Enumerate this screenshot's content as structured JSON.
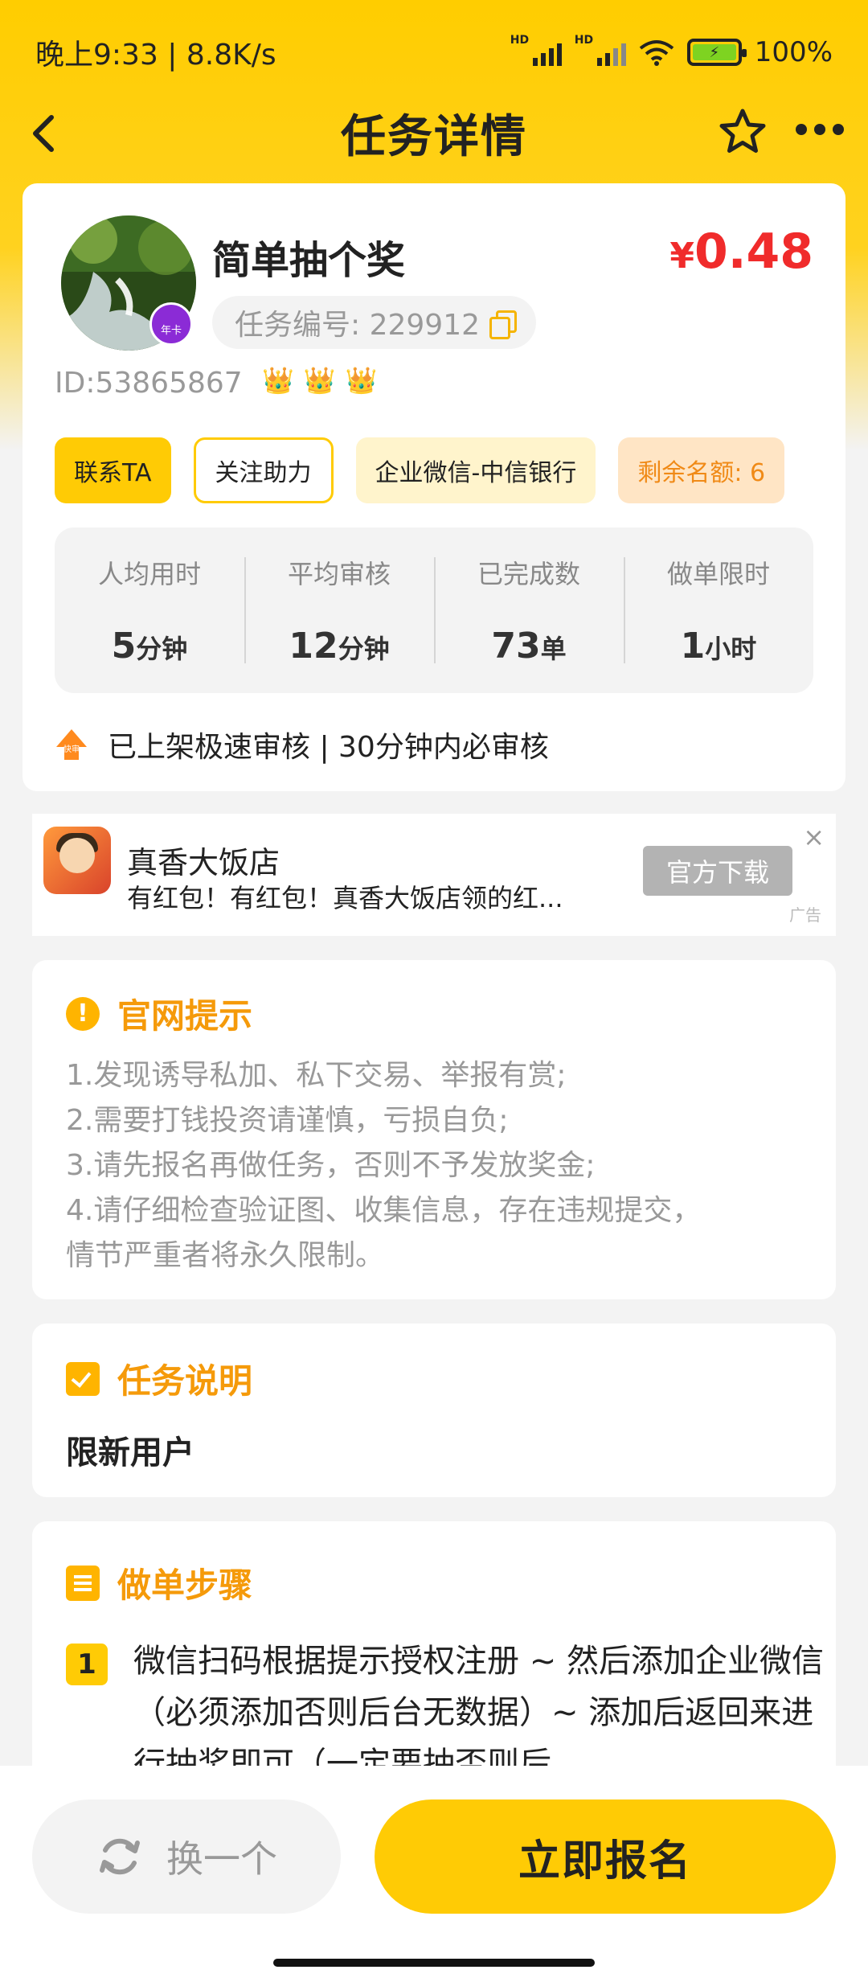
{
  "status_bar": {
    "time_speed": "晚上9:33 | 8.8K/s",
    "battery": "100%",
    "hd1": "HD",
    "hd2": "HD"
  },
  "header": {
    "title": "任务详情"
  },
  "task": {
    "name": "简单抽个奖",
    "price_currency": "¥",
    "price_value": "0.48",
    "task_id_label": "任务编号: 229912",
    "user_id": "ID:53865867",
    "avatar_badge": "年卡",
    "crowns": [
      "👑",
      "👑",
      "👑"
    ]
  },
  "tags": {
    "contact": "联系TA",
    "follow": "关注助力",
    "company": "企业微信-中信银行",
    "remaining": "剩余名额: 6"
  },
  "stats": [
    {
      "label": "人均用时",
      "value": "5",
      "unit": "分钟"
    },
    {
      "label": "平均审核",
      "value": "12",
      "unit": "分钟"
    },
    {
      "label": "已完成数",
      "value": "73",
      "unit": "单"
    },
    {
      "label": "做单限时",
      "value": "1",
      "unit": "小时"
    }
  ],
  "fast_review": {
    "icon_text": "快审",
    "text": "已上架极速审核 | 30分钟内必审核"
  },
  "ad": {
    "title": "真香大饭店",
    "description": "有红包！有红包！真香大饭店领的红...",
    "button": "官方下载",
    "close": "×",
    "label": "广告"
  },
  "notice": {
    "title": "官网提示",
    "lines": [
      "1.发现诱导私加、私下交易、举报有赏;",
      "2.需要打钱投资请谨慎，亏损自负;",
      "3.请先报名再做任务，否则不予发放奖金;",
      "4.请仔细检查验证图、收集信息，存在违规提交，",
      "情节严重者将永久限制。"
    ]
  },
  "description": {
    "title": "任务说明",
    "body": "限新用户"
  },
  "steps": {
    "title": "做单步骤",
    "items": [
      {
        "num": "1",
        "text": "微信扫码根据提示授权注册 ~ 然后添加企业微信（必须添加否则后台无数据）~ 添加后返回来进行抽奖即可（一定要抽否则后"
      }
    ]
  },
  "bottom": {
    "change": "换一个",
    "signup": "立即报名"
  },
  "colors": {
    "brand_yellow": "#ffcb05",
    "price_red": "#f02b2b",
    "section_orange": "#f59a0a"
  }
}
